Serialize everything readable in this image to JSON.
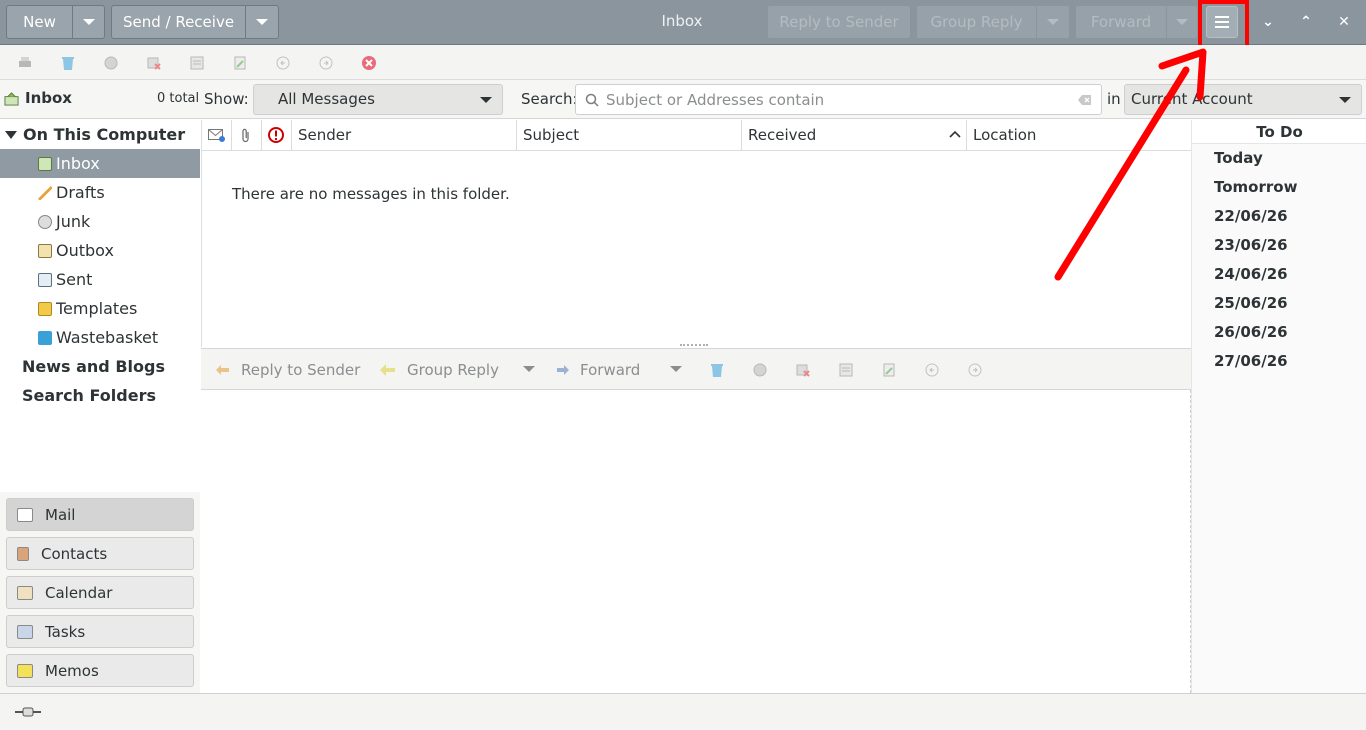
{
  "header": {
    "new_label": "New",
    "send_receive_label": "Send / Receive",
    "title": "Inbox",
    "reply_to_sender_label": "Reply to Sender",
    "group_reply_label": "Group Reply",
    "forward_label": "Forward"
  },
  "toolbar": {
    "icons": [
      "print-icon",
      "delete-icon",
      "junk-icon",
      "not-junk-icon",
      "archive-icon",
      "move-icon",
      "previous-icon",
      "next-icon",
      "stop-icon"
    ]
  },
  "searchbar": {
    "folder_name": "Inbox",
    "total": "0 total",
    "show_label": "Show:",
    "show_value": "All Messages",
    "search_label": "Search:",
    "search_placeholder": "Subject or Addresses contain",
    "in_label": "in",
    "scope_value": "Current Account"
  },
  "sidebar": {
    "account": "On This Computer",
    "folders": [
      "Inbox",
      "Drafts",
      "Junk",
      "Outbox",
      "Sent",
      "Templates",
      "Wastebasket"
    ],
    "news": "News and Blogs",
    "search_folders": "Search Folders"
  },
  "switcher": {
    "items": [
      "Mail",
      "Contacts",
      "Calendar",
      "Tasks",
      "Memos"
    ]
  },
  "message_list": {
    "columns": [
      "Sender",
      "Subject",
      "Received",
      "Location"
    ],
    "empty_text": "There are no messages in this folder."
  },
  "preview_toolbar": {
    "reply_to_sender": "Reply to Sender",
    "group_reply": "Group Reply",
    "forward": "Forward"
  },
  "todo": {
    "title": "To Do",
    "rows": [
      "Today",
      "Tomorrow",
      "22/06/26",
      "23/06/26",
      "24/06/26",
      "25/06/26",
      "26/06/26",
      "27/06/26"
    ]
  },
  "colors": {
    "header_bg": "#8a959e",
    "selection_bg": "#8f9aa3",
    "annotation_red": "#ff0000"
  }
}
